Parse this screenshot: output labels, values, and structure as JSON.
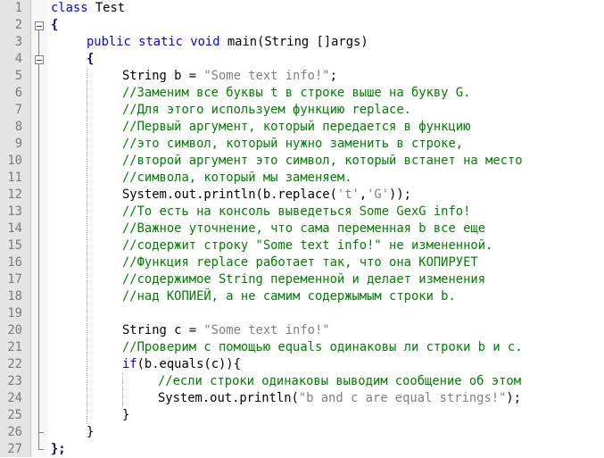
{
  "editor": {
    "lines": [
      {
        "no": "1",
        "indent": 0,
        "tokens": [
          {
            "t": "class",
            "c": "kw"
          },
          {
            "t": " Test",
            "c": ""
          }
        ]
      },
      {
        "no": "2",
        "indent": 0,
        "tokens": [
          {
            "t": "{",
            "c": "punct"
          }
        ]
      },
      {
        "no": "3",
        "indent": 1,
        "tokens": [
          {
            "t": "public static void",
            "c": "kw"
          },
          {
            "t": " main(String []args)",
            "c": ""
          }
        ]
      },
      {
        "no": "4",
        "indent": 1,
        "tokens": [
          {
            "t": "{",
            "c": "punct"
          }
        ]
      },
      {
        "no": "5",
        "indent": 2,
        "tokens": [
          {
            "t": "String b = ",
            "c": ""
          },
          {
            "t": "\"Some text info!\"",
            "c": "str"
          },
          {
            "t": ";",
            "c": ""
          }
        ]
      },
      {
        "no": "6",
        "indent": 2,
        "tokens": [
          {
            "t": "//Заменим все буквы t в строке выше на букву G.",
            "c": "cm"
          }
        ]
      },
      {
        "no": "7",
        "indent": 2,
        "tokens": [
          {
            "t": "//Для этого используем функцию replace.",
            "c": "cm"
          }
        ]
      },
      {
        "no": "8",
        "indent": 2,
        "tokens": [
          {
            "t": "//Первый аргумент, который передается в функцию",
            "c": "cm"
          }
        ]
      },
      {
        "no": "9",
        "indent": 2,
        "tokens": [
          {
            "t": "//это символ, который нужно заменить в строке,",
            "c": "cm"
          }
        ]
      },
      {
        "no": "10",
        "indent": 2,
        "tokens": [
          {
            "t": "//второй аргумент это символ, который встанет на место",
            "c": "cm"
          }
        ]
      },
      {
        "no": "11",
        "indent": 2,
        "tokens": [
          {
            "t": "//символа, который мы заменяем.",
            "c": "cm"
          }
        ]
      },
      {
        "no": "12",
        "indent": 2,
        "tokens": [
          {
            "t": "System.out.println(b.replace(",
            "c": ""
          },
          {
            "t": "'t'",
            "c": "str"
          },
          {
            "t": ",",
            "c": ""
          },
          {
            "t": "'G'",
            "c": "str"
          },
          {
            "t": "));",
            "c": ""
          }
        ]
      },
      {
        "no": "13",
        "indent": 2,
        "tokens": [
          {
            "t": "//То есть на консоль выведеться Some GexG info!",
            "c": "cm"
          }
        ]
      },
      {
        "no": "14",
        "indent": 2,
        "tokens": [
          {
            "t": "//Важное уточнение, что сама переменная b все еще",
            "c": "cm"
          }
        ]
      },
      {
        "no": "15",
        "indent": 2,
        "tokens": [
          {
            "t": "//содержит строку \"Some text info!\" не измененной.",
            "c": "cm"
          }
        ]
      },
      {
        "no": "16",
        "indent": 2,
        "tokens": [
          {
            "t": "//Функция replace работает так, что она КОПИРУЕТ",
            "c": "cm"
          }
        ]
      },
      {
        "no": "17",
        "indent": 2,
        "tokens": [
          {
            "t": "//содержимое String переменной и делает изменения",
            "c": "cm"
          }
        ]
      },
      {
        "no": "18",
        "indent": 2,
        "tokens": [
          {
            "t": "//над КОПИЕЙ, а не самим содержымым строки b.",
            "c": "cm"
          }
        ]
      },
      {
        "no": "19",
        "indent": 2,
        "tokens": []
      },
      {
        "no": "20",
        "indent": 2,
        "tokens": [
          {
            "t": "String c = ",
            "c": ""
          },
          {
            "t": "\"Some text info!\"",
            "c": "str"
          }
        ]
      },
      {
        "no": "21",
        "indent": 2,
        "tokens": [
          {
            "t": "//Проверим с помощью equals одинаковы ли строки b и c.",
            "c": "cm"
          }
        ]
      },
      {
        "no": "22",
        "indent": 2,
        "tokens": [
          {
            "t": "if",
            "c": "kw"
          },
          {
            "t": "(b.equals(c)){",
            "c": ""
          }
        ]
      },
      {
        "no": "23",
        "indent": 3,
        "tokens": [
          {
            "t": "//если строки одинаковы выводим сообщение об этом",
            "c": "cm"
          }
        ]
      },
      {
        "no": "24",
        "indent": 3,
        "tokens": [
          {
            "t": "System.out.println(",
            "c": ""
          },
          {
            "t": "\"b and c are equal strings!\"",
            "c": "str"
          },
          {
            "t": ");",
            "c": ""
          }
        ]
      },
      {
        "no": "25",
        "indent": 2,
        "tokens": [
          {
            "t": "}",
            "c": ""
          }
        ]
      },
      {
        "no": "26",
        "indent": 1,
        "tokens": [
          {
            "t": "}",
            "c": ""
          }
        ]
      },
      {
        "no": "27",
        "indent": 0,
        "tokens": [
          {
            "t": "};",
            "c": "punct"
          }
        ]
      }
    ]
  },
  "colors": {
    "keyword": "#0000ff",
    "string": "#808080",
    "comment": "#008000",
    "gutter_bg": "#e4e4e4",
    "line_number": "#7a7a7a"
  }
}
